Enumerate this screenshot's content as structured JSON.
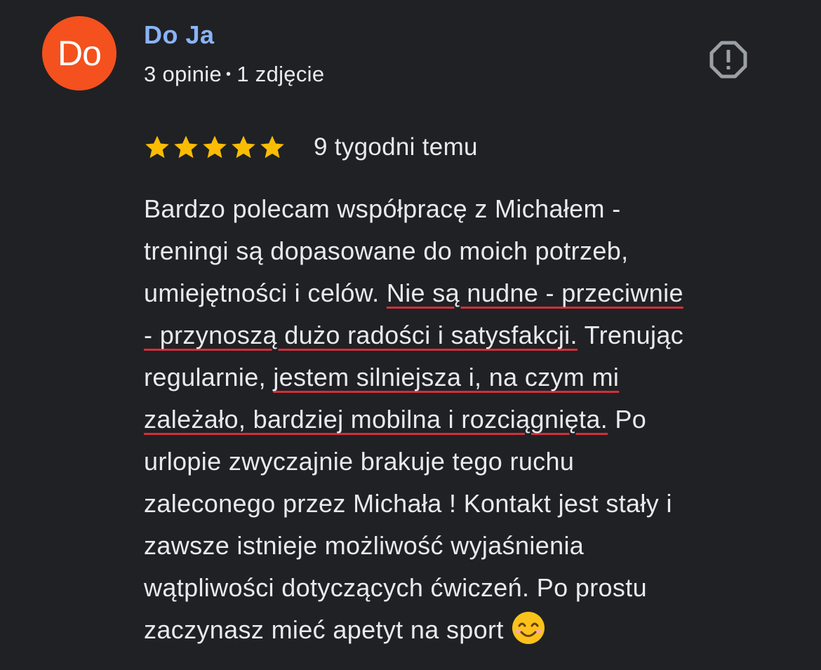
{
  "colors": {
    "background": "#202124",
    "avatar_bg": "#f4511e",
    "author_name": "#8ab4f8",
    "text": "#e8eaed",
    "star": "#fbbc04",
    "icon": "#9aa0a6",
    "highlight_underline": "#d32f3b"
  },
  "reviewer": {
    "avatar_text": "Do",
    "name": "Do Ja",
    "reviews_count": "3 opinie",
    "separator": "•",
    "photos_count": "1 zdjęcie"
  },
  "report_icon": "report-octagon-icon",
  "review": {
    "rating": 5,
    "max_rating": 5,
    "star_icon": "star-icon",
    "date": "9 tygodni temu",
    "lines": [
      [
        {
          "text": "Bardzo polecam współpracę z Michałem -",
          "highlight": false
        }
      ],
      [
        {
          "text": "treningi są dopasowane do moich potrzeb,",
          "highlight": false
        }
      ],
      [
        {
          "text": "umiejętności i celów. ",
          "highlight": false
        },
        {
          "text": "Nie są nudne - przeciwnie",
          "highlight": true
        }
      ],
      [
        {
          "text": "- przynoszą dużo radości i satysfakcji.",
          "highlight": true
        },
        {
          "text": " Trenując",
          "highlight": false
        }
      ],
      [
        {
          "text": "regularnie, ",
          "highlight": false
        },
        {
          "text": "jestem silniejsza i, na czym mi",
          "highlight": true
        }
      ],
      [
        {
          "text": "zależało, bardziej mobilna i rozciągnięta.",
          "highlight": true
        },
        {
          "text": " Po",
          "highlight": false
        }
      ],
      [
        {
          "text": "urlopie zwyczajnie brakuje tego ruchu",
          "highlight": false
        }
      ],
      [
        {
          "text": "zaleconego przez Michała ! Kontakt jest stały i",
          "highlight": false
        }
      ],
      [
        {
          "text": "zawsze istnieje możliwość wyjaśnienia",
          "highlight": false
        }
      ],
      [
        {
          "text": "wątpliwości dotyczących ćwiczeń. Po prostu",
          "highlight": false
        }
      ],
      [
        {
          "text": "zaczynasz mieć apetyt na sport",
          "highlight": false
        }
      ]
    ],
    "end_emoji": "smiling-face-emoji-icon"
  }
}
